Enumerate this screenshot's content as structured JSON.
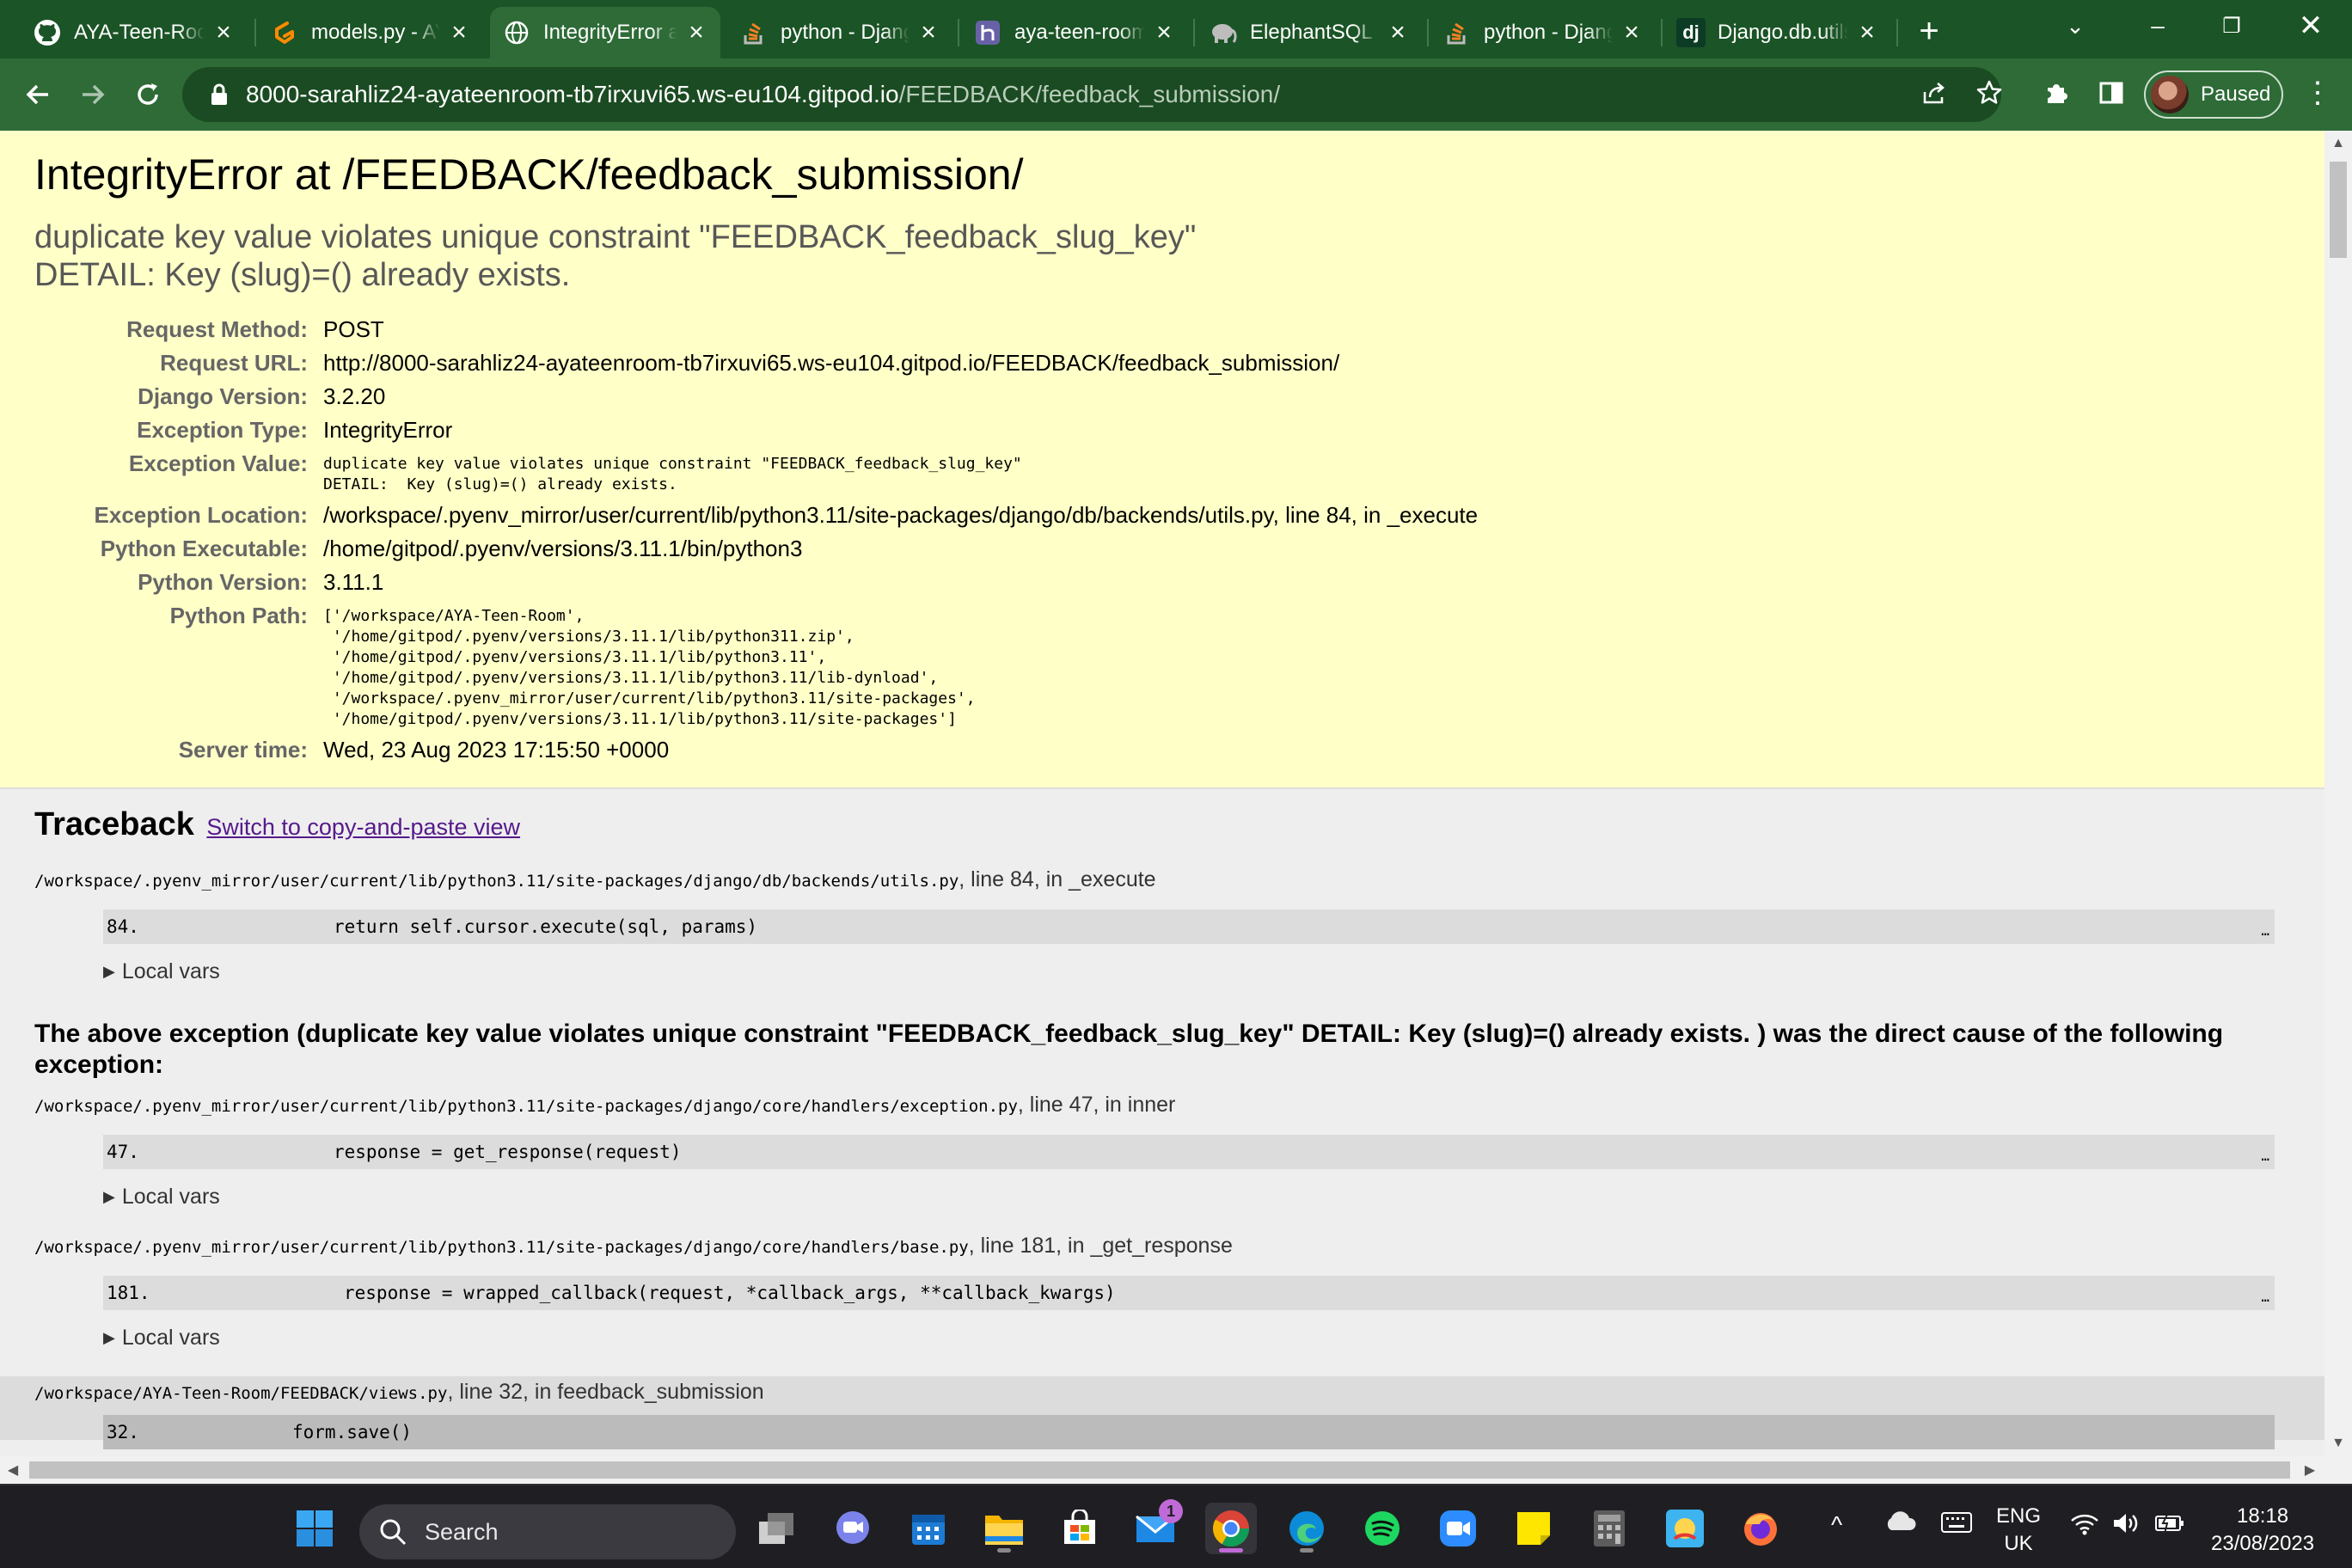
{
  "browser": {
    "tabs": [
      {
        "title": "AYA-Teen-Room",
        "icon": "github-icon",
        "active": false
      },
      {
        "title": "models.py - AYA",
        "icon": "gitpod-icon",
        "active": false
      },
      {
        "title": "IntegrityError at",
        "icon": "globe-icon",
        "active": true
      },
      {
        "title": "python - Django",
        "icon": "stackoverflow-icon",
        "active": false
      },
      {
        "title": "aya-teen-room",
        "icon": "heroku-icon",
        "active": false
      },
      {
        "title": "ElephantSQL",
        "icon": "elephant-icon",
        "active": false
      },
      {
        "title": "python - Django",
        "icon": "stackoverflow-icon",
        "active": false
      },
      {
        "title": "Django.db.utils",
        "icon": "django-icon",
        "active": false
      }
    ],
    "url_host": "8000-sarahliz24-ayateenroom-tb7irxuvi65.ws-eu104.gitpod.io",
    "url_path": "/FEEDBACK/feedback_submission/",
    "profile_label": "Paused",
    "colors": {
      "tabstrip": "#1b5426",
      "toolbar": "#2e6b37"
    }
  },
  "error": {
    "heading": "IntegrityError at /FEEDBACK/feedback_submission/",
    "exception_value": "duplicate key value violates unique constraint \"FEEDBACK_feedback_slug_key\"\nDETAIL:  Key (slug)=() already exists.",
    "meta": {
      "request_method_label": "Request Method:",
      "request_method": "POST",
      "request_url_label": "Request URL:",
      "request_url": "http://8000-sarahliz24-ayateenroom-tb7irxuvi65.ws-eu104.gitpod.io/FEEDBACK/feedback_submission/",
      "django_version_label": "Django Version:",
      "django_version": "3.2.20",
      "exception_type_label": "Exception Type:",
      "exception_type": "IntegrityError",
      "exception_value_label": "Exception Value:",
      "exception_value": "duplicate key value violates unique constraint \"FEEDBACK_feedback_slug_key\"\nDETAIL:  Key (slug)=() already exists.",
      "exception_location_label": "Exception Location:",
      "exception_location": "/workspace/.pyenv_mirror/user/current/lib/python3.11/site-packages/django/db/backends/utils.py, line 84, in _execute",
      "python_executable_label": "Python Executable:",
      "python_executable": "/home/gitpod/.pyenv/versions/3.11.1/bin/python3",
      "python_version_label": "Python Version:",
      "python_version": "3.11.1",
      "python_path_label": "Python Path:",
      "python_path": "['/workspace/AYA-Teen-Room',\n '/home/gitpod/.pyenv/versions/3.11.1/lib/python311.zip',\n '/home/gitpod/.pyenv/versions/3.11.1/lib/python3.11',\n '/home/gitpod/.pyenv/versions/3.11.1/lib/python3.11/lib-dynload',\n '/workspace/.pyenv_mirror/user/current/lib/python3.11/site-packages',\n '/home/gitpod/.pyenv/versions/3.11.1/lib/python3.11/site-packages']",
      "server_time_label": "Server time:",
      "server_time": "Wed, 23 Aug 2023 17:15:50 +0000"
    },
    "bg_color": "#ffffc8"
  },
  "traceback": {
    "title": "Traceback",
    "switch_link": "Switch to copy-and-paste view",
    "local_vars_label": "Local vars",
    "frames": [
      {
        "file": "/workspace/.pyenv_mirror/user/current/lib/python3.11/site-packages/django/db/backends/utils.py",
        "where": ", line 84, in _execute",
        "line_no": "84.",
        "code": "return self.cursor.execute(sql, params)"
      },
      {
        "file": "/workspace/.pyenv_mirror/user/current/lib/python3.11/site-packages/django/core/handlers/exception.py",
        "where": ", line 47, in inner",
        "line_no": "47.",
        "code": "response = get_response(request)"
      },
      {
        "file": "/workspace/.pyenv_mirror/user/current/lib/python3.11/site-packages/django/core/handlers/base.py",
        "where": ", line 181, in _get_response",
        "line_no": "181.",
        "code": "response = wrapped_callback(request, *callback_args, **callback_kwargs)"
      },
      {
        "file": "/workspace/AYA-Teen-Room/FEEDBACK/views.py",
        "where": ", line 32, in feedback_submission",
        "line_no": "32.",
        "code": "form.save()"
      }
    ],
    "cause_text": "The above exception (duplicate key value violates unique constraint \"FEEDBACK_feedback_slug_key\" DETAIL: Key (slug)=() already exists. ) was the direct cause of the following exception:",
    "ellipsis": "…"
  },
  "taskbar": {
    "search_label": "Search",
    "mail_badge": "1",
    "lang_top": "ENG",
    "lang_bottom": "UK",
    "time": "18:18",
    "date": "23/08/2023",
    "icons": [
      "windows-start-icon",
      "task-view-icon",
      "chat-icon",
      "calendar-icon",
      "file-explorer-icon",
      "store-icon",
      "mail-icon",
      "chrome-icon",
      "edge-icon",
      "spotify-icon",
      "zoom-icon",
      "sticky-notes-icon",
      "calculator-icon",
      "game-icon",
      "firefox-icon"
    ]
  }
}
